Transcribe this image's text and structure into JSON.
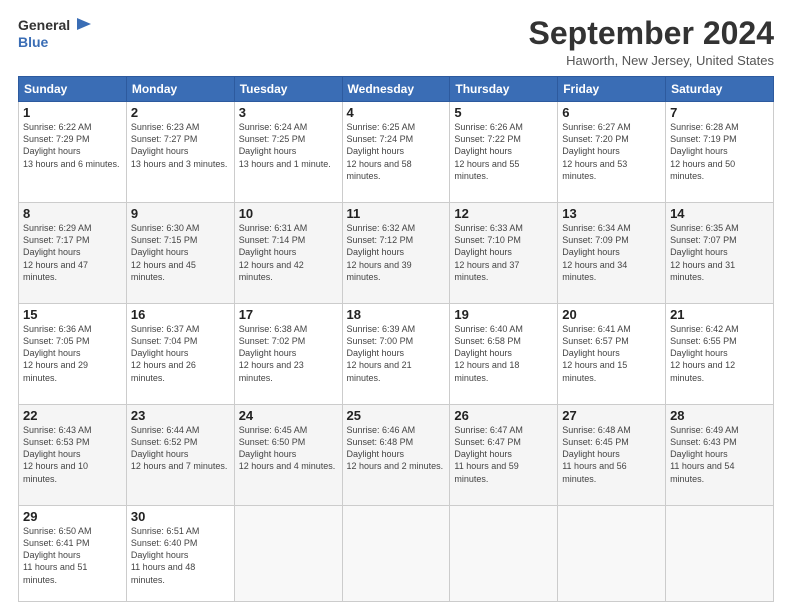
{
  "header": {
    "logo_line1": "General",
    "logo_line2": "Blue",
    "month": "September 2024",
    "location": "Haworth, New Jersey, United States"
  },
  "days_of_week": [
    "Sunday",
    "Monday",
    "Tuesday",
    "Wednesday",
    "Thursday",
    "Friday",
    "Saturday"
  ],
  "weeks": [
    [
      {
        "day": "1",
        "sunrise": "6:22 AM",
        "sunset": "7:29 PM",
        "daylight": "13 hours and 6 minutes."
      },
      {
        "day": "2",
        "sunrise": "6:23 AM",
        "sunset": "7:27 PM",
        "daylight": "13 hours and 3 minutes."
      },
      {
        "day": "3",
        "sunrise": "6:24 AM",
        "sunset": "7:25 PM",
        "daylight": "13 hours and 1 minute."
      },
      {
        "day": "4",
        "sunrise": "6:25 AM",
        "sunset": "7:24 PM",
        "daylight": "12 hours and 58 minutes."
      },
      {
        "day": "5",
        "sunrise": "6:26 AM",
        "sunset": "7:22 PM",
        "daylight": "12 hours and 55 minutes."
      },
      {
        "day": "6",
        "sunrise": "6:27 AM",
        "sunset": "7:20 PM",
        "daylight": "12 hours and 53 minutes."
      },
      {
        "day": "7",
        "sunrise": "6:28 AM",
        "sunset": "7:19 PM",
        "daylight": "12 hours and 50 minutes."
      }
    ],
    [
      {
        "day": "8",
        "sunrise": "6:29 AM",
        "sunset": "7:17 PM",
        "daylight": "12 hours and 47 minutes."
      },
      {
        "day": "9",
        "sunrise": "6:30 AM",
        "sunset": "7:15 PM",
        "daylight": "12 hours and 45 minutes."
      },
      {
        "day": "10",
        "sunrise": "6:31 AM",
        "sunset": "7:14 PM",
        "daylight": "12 hours and 42 minutes."
      },
      {
        "day": "11",
        "sunrise": "6:32 AM",
        "sunset": "7:12 PM",
        "daylight": "12 hours and 39 minutes."
      },
      {
        "day": "12",
        "sunrise": "6:33 AM",
        "sunset": "7:10 PM",
        "daylight": "12 hours and 37 minutes."
      },
      {
        "day": "13",
        "sunrise": "6:34 AM",
        "sunset": "7:09 PM",
        "daylight": "12 hours and 34 minutes."
      },
      {
        "day": "14",
        "sunrise": "6:35 AM",
        "sunset": "7:07 PM",
        "daylight": "12 hours and 31 minutes."
      }
    ],
    [
      {
        "day": "15",
        "sunrise": "6:36 AM",
        "sunset": "7:05 PM",
        "daylight": "12 hours and 29 minutes."
      },
      {
        "day": "16",
        "sunrise": "6:37 AM",
        "sunset": "7:04 PM",
        "daylight": "12 hours and 26 minutes."
      },
      {
        "day": "17",
        "sunrise": "6:38 AM",
        "sunset": "7:02 PM",
        "daylight": "12 hours and 23 minutes."
      },
      {
        "day": "18",
        "sunrise": "6:39 AM",
        "sunset": "7:00 PM",
        "daylight": "12 hours and 21 minutes."
      },
      {
        "day": "19",
        "sunrise": "6:40 AM",
        "sunset": "6:58 PM",
        "daylight": "12 hours and 18 minutes."
      },
      {
        "day": "20",
        "sunrise": "6:41 AM",
        "sunset": "6:57 PM",
        "daylight": "12 hours and 15 minutes."
      },
      {
        "day": "21",
        "sunrise": "6:42 AM",
        "sunset": "6:55 PM",
        "daylight": "12 hours and 12 minutes."
      }
    ],
    [
      {
        "day": "22",
        "sunrise": "6:43 AM",
        "sunset": "6:53 PM",
        "daylight": "12 hours and 10 minutes."
      },
      {
        "day": "23",
        "sunrise": "6:44 AM",
        "sunset": "6:52 PM",
        "daylight": "12 hours and 7 minutes."
      },
      {
        "day": "24",
        "sunrise": "6:45 AM",
        "sunset": "6:50 PM",
        "daylight": "12 hours and 4 minutes."
      },
      {
        "day": "25",
        "sunrise": "6:46 AM",
        "sunset": "6:48 PM",
        "daylight": "12 hours and 2 minutes."
      },
      {
        "day": "26",
        "sunrise": "6:47 AM",
        "sunset": "6:47 PM",
        "daylight": "11 hours and 59 minutes."
      },
      {
        "day": "27",
        "sunrise": "6:48 AM",
        "sunset": "6:45 PM",
        "daylight": "11 hours and 56 minutes."
      },
      {
        "day": "28",
        "sunrise": "6:49 AM",
        "sunset": "6:43 PM",
        "daylight": "11 hours and 54 minutes."
      }
    ],
    [
      {
        "day": "29",
        "sunrise": "6:50 AM",
        "sunset": "6:41 PM",
        "daylight": "11 hours and 51 minutes."
      },
      {
        "day": "30",
        "sunrise": "6:51 AM",
        "sunset": "6:40 PM",
        "daylight": "11 hours and 48 minutes."
      },
      null,
      null,
      null,
      null,
      null
    ]
  ]
}
